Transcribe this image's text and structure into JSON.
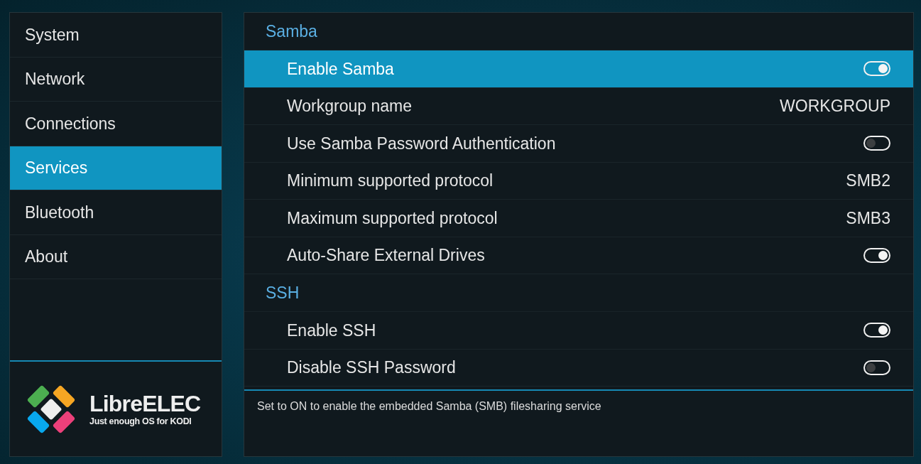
{
  "sidebar": {
    "items": [
      {
        "label": "System",
        "selected": false
      },
      {
        "label": "Network",
        "selected": false
      },
      {
        "label": "Connections",
        "selected": false
      },
      {
        "label": "Services",
        "selected": true
      },
      {
        "label": "Bluetooth",
        "selected": false
      },
      {
        "label": "About",
        "selected": false
      }
    ]
  },
  "logo": {
    "wordmark": "LibreELEC",
    "tagline": "Just enough OS for KODI"
  },
  "settings": {
    "sections": [
      {
        "title": "Samba",
        "items": [
          {
            "label": "Enable Samba",
            "kind": "toggle",
            "on": true,
            "selected": true
          },
          {
            "label": "Workgroup name",
            "kind": "value",
            "value": "WORKGROUP",
            "selected": false
          },
          {
            "label": "Use Samba Password Authentication",
            "kind": "toggle",
            "on": false,
            "selected": false
          },
          {
            "label": "Minimum supported protocol",
            "kind": "value",
            "value": "SMB2",
            "selected": false
          },
          {
            "label": "Maximum supported protocol",
            "kind": "value",
            "value": "SMB3",
            "selected": false
          },
          {
            "label": "Auto-Share External Drives",
            "kind": "toggle",
            "on": true,
            "selected": false
          }
        ]
      },
      {
        "title": "SSH",
        "items": [
          {
            "label": "Enable SSH",
            "kind": "toggle",
            "on": true,
            "selected": false
          },
          {
            "label": "Disable SSH Password",
            "kind": "toggle",
            "on": false,
            "selected": false
          }
        ]
      }
    ]
  },
  "description": "Set to ON to enable the embedded Samba (SMB) filesharing service"
}
